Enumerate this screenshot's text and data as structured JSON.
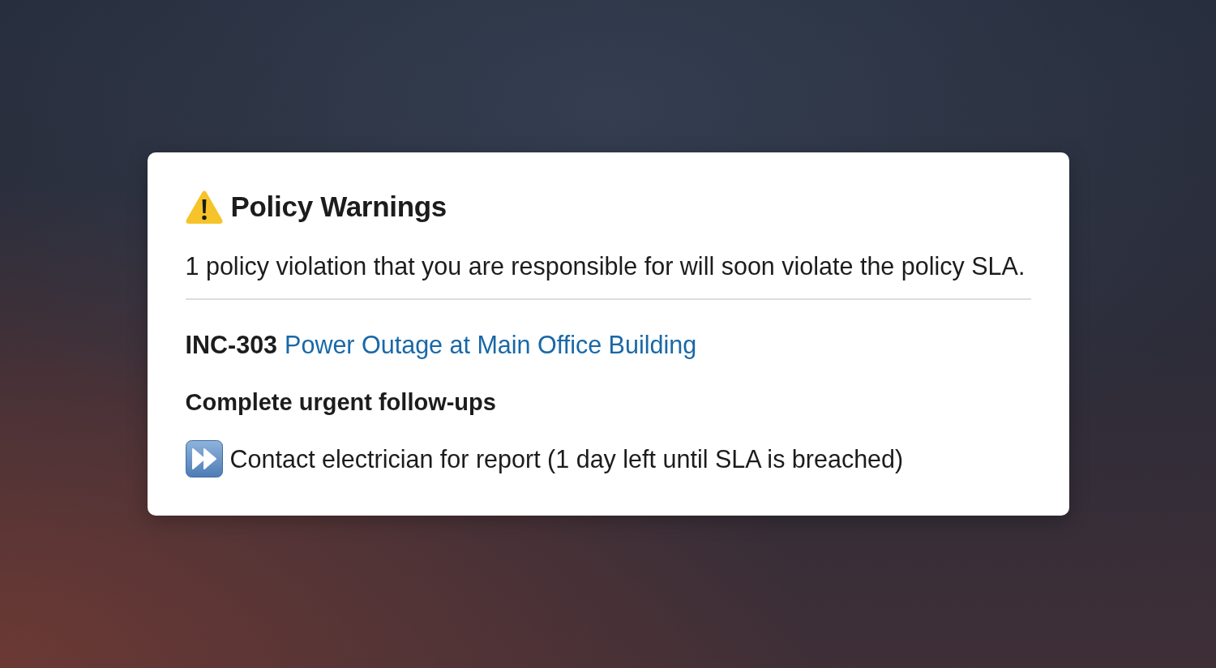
{
  "card": {
    "title": "Policy Warnings",
    "summary": "1 policy violation that you are responsible for will soon violate the policy SLA.",
    "incident": {
      "id": "INC-303",
      "title": "Power Outage at Main Office Building"
    },
    "section_heading": "Complete urgent follow-ups",
    "tasks": [
      {
        "text": "Contact electrician for report (1 day left until SLA is breached)"
      }
    ]
  }
}
